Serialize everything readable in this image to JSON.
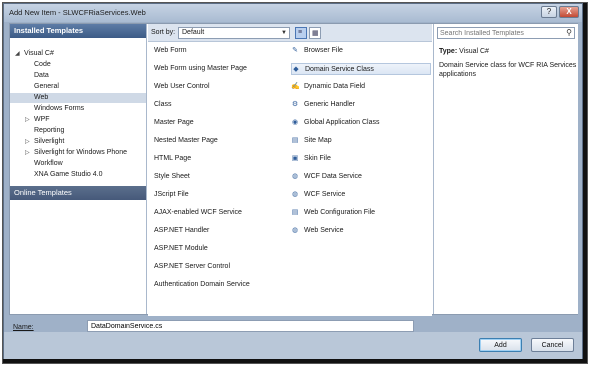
{
  "window": {
    "title": "Add New Item - SLWCFRiaServices.Web",
    "help_glyph": "?",
    "close_glyph": "X"
  },
  "left_pane": {
    "header": "Installed Templates",
    "tree": [
      {
        "label": "Visual C#",
        "level": 0,
        "expanded": true
      },
      {
        "label": "Code",
        "level": 1
      },
      {
        "label": "Data",
        "level": 1
      },
      {
        "label": "General",
        "level": 1
      },
      {
        "label": "Web",
        "level": 1,
        "selected": true
      },
      {
        "label": "Windows Forms",
        "level": 1
      },
      {
        "label": "WPF",
        "level": 1,
        "collapsed": true
      },
      {
        "label": "Reporting",
        "level": 1
      },
      {
        "label": "Silverlight",
        "level": 1,
        "collapsed": true
      },
      {
        "label": "Silverlight for Windows Phone",
        "level": 1,
        "collapsed": true
      },
      {
        "label": "Workflow",
        "level": 1
      },
      {
        "label": "XNA Game Studio 4.0",
        "level": 1
      }
    ],
    "online_templates": "Online Templates"
  },
  "toolbar": {
    "sort_label": "Sort by:",
    "sort_value": "Default"
  },
  "templates": {
    "column1": [
      "Web Form",
      "Web Form using Master Page",
      "Web User Control",
      "Class",
      "Master Page",
      "Nested Master Page",
      "HTML Page",
      "Style Sheet",
      "JScript File",
      "AJAX-enabled WCF Service",
      "ASP.NET Handler",
      "ASP.NET Module",
      "ASP.NET Server Control",
      "Authentication Domain Service"
    ],
    "column2": [
      "Browser File",
      "Domain Service Class",
      "Dynamic Data Field",
      "Generic Handler",
      "Global Application Class",
      "Site Map",
      "Skin File",
      "WCF Data Service",
      "WCF Service",
      "Web Configuration File",
      "Web Service"
    ],
    "selected": "Domain Service Class"
  },
  "right_pane": {
    "search_placeholder": "Search Installed Templates",
    "type_label": "Type:",
    "type_value": "Visual C#",
    "description": "Domain Service class for WCF RIA Services applications"
  },
  "name_field": {
    "label": "Name:",
    "value": "DataDomainService.cs"
  },
  "buttons": {
    "add": "Add",
    "cancel": "Cancel"
  }
}
